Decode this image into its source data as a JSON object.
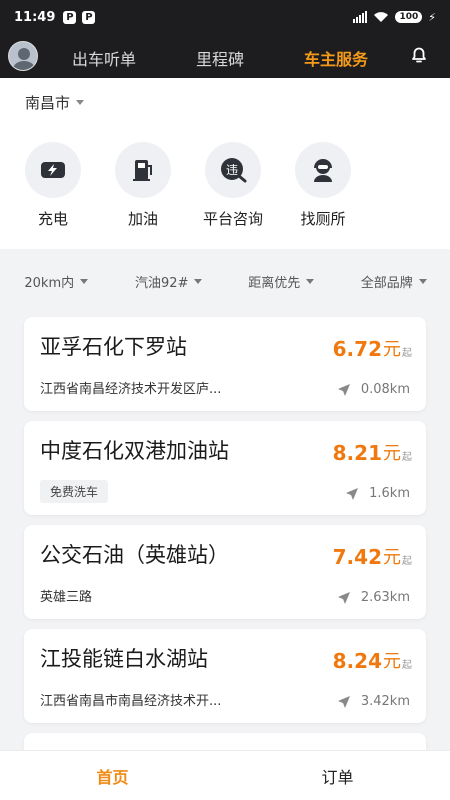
{
  "status_bar": {
    "time": "11:49",
    "notif_icons": [
      "P",
      "P"
    ],
    "battery": "100"
  },
  "top_nav": {
    "tabs": [
      {
        "label": "出车听单",
        "active": false
      },
      {
        "label": "里程碑",
        "active": false
      },
      {
        "label": "车主服务",
        "active": true
      }
    ]
  },
  "city": {
    "label": "南昌市"
  },
  "services": [
    {
      "label": "充电",
      "icon": "charge-icon"
    },
    {
      "label": "加油",
      "icon": "fuel-icon"
    },
    {
      "label": "平台咨询",
      "icon": "consult-icon"
    },
    {
      "label": "找厕所",
      "icon": "support-icon"
    }
  ],
  "filters": [
    {
      "label": "20km内"
    },
    {
      "label": "汽油92#"
    },
    {
      "label": "距离优先"
    },
    {
      "label": "全部品牌"
    }
  ],
  "stations": [
    {
      "name": "亚孚石化下罗站",
      "sub": "江西省南昌经济技术开发区庐...",
      "tag": "",
      "price": "6.72",
      "unit": "元",
      "suffix": "起",
      "distance": "0.08km"
    },
    {
      "name": "中度石化双港加油站",
      "sub": "",
      "tag": "免费洗车",
      "price": "8.21",
      "unit": "元",
      "suffix": "起",
      "distance": "1.6km"
    },
    {
      "name": "公交石油（英雄站）",
      "sub": "英雄三路",
      "tag": "",
      "price": "7.42",
      "unit": "元",
      "suffix": "起",
      "distance": "2.63km"
    },
    {
      "name": "江投能链白水湖站",
      "sub": "江西省南昌市南昌经济技术开...",
      "tag": "",
      "price": "8.24",
      "unit": "元",
      "suffix": "起",
      "distance": "3.42km"
    }
  ],
  "bottom_tabs": [
    {
      "label": "首页",
      "active": true
    },
    {
      "label": "订单",
      "active": false
    }
  ],
  "colors": {
    "accent": "#f39a1a",
    "price": "#f0790f",
    "dark_bar": "#1d1d1f"
  }
}
